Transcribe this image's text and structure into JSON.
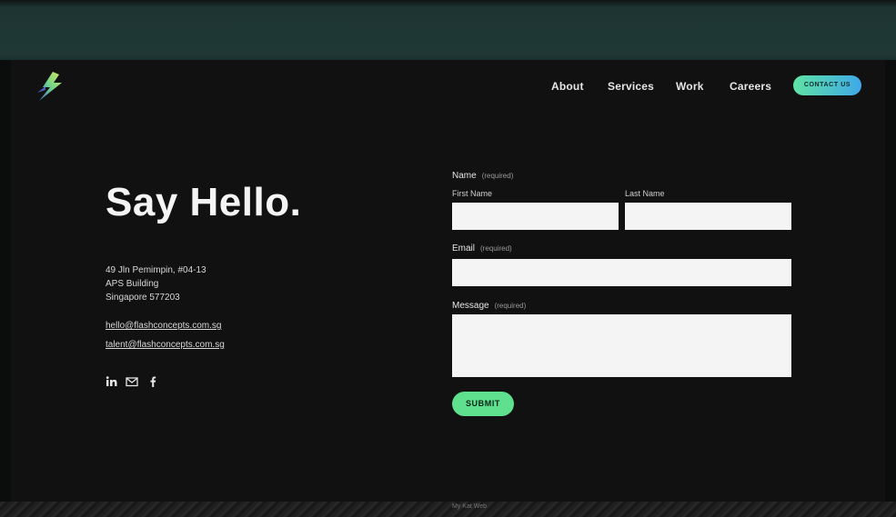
{
  "nav": {
    "items": [
      {
        "label": "About"
      },
      {
        "label": "Services"
      },
      {
        "label": "Work"
      },
      {
        "label": "Careers"
      }
    ],
    "cta_label": "contact us"
  },
  "contact": {
    "heading": "Say Hello.",
    "address": [
      "49 Jln Pemimpin, #04-13",
      "APS Building",
      "Singapore 577203"
    ],
    "emails": [
      "hello@flashconcepts.com.sg",
      "talent@flashconcepts.com.sg"
    ],
    "social_icons": [
      "linkedin-icon",
      "mail-icon",
      "facebook-icon"
    ]
  },
  "form": {
    "name_label": "Name",
    "required_text": "(required)",
    "first_name_label": "First Name",
    "last_name_label": "Last Name",
    "email_label": "Email",
    "message_label": "Message",
    "submit_label": "SUBMIT",
    "first_name_value": "",
    "last_name_value": "",
    "email_value": "",
    "message_value": ""
  },
  "footer": {
    "label": "My Kat Web"
  },
  "colors": {
    "accent_green": "#5fe08f",
    "accent_blue": "#3fa8e8",
    "panel": "#111111",
    "top_band": "#1f3836"
  }
}
